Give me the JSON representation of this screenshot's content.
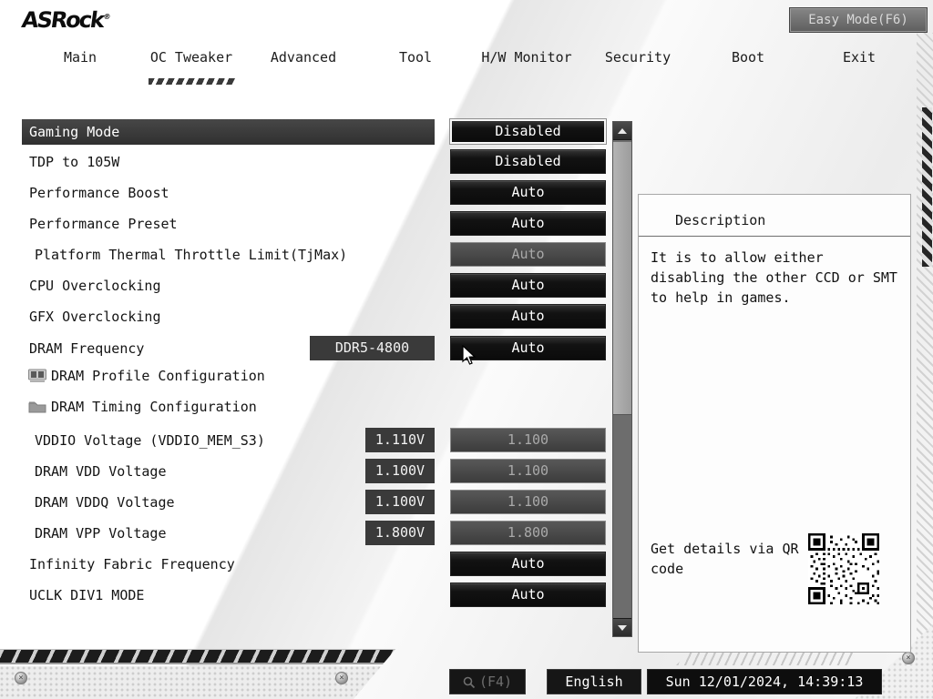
{
  "header": {
    "logo_text": "ASRock",
    "logo_mark": "®",
    "easy_mode_label": "Easy Mode(F6)"
  },
  "tabs": [
    {
      "label": "Main",
      "active": false
    },
    {
      "label": "OC Tweaker",
      "active": true
    },
    {
      "label": "Advanced",
      "active": false
    },
    {
      "label": "Tool",
      "active": false
    },
    {
      "label": "H/W Monitor",
      "active": false
    },
    {
      "label": "Security",
      "active": false
    },
    {
      "label": "Boot",
      "active": false
    },
    {
      "label": "Exit",
      "active": false
    }
  ],
  "settings": {
    "rows": [
      {
        "label": "Gaming Mode",
        "value": "Disabled",
        "state": "selected"
      },
      {
        "label": "TDP to 105W",
        "value": "Disabled",
        "state": "normal"
      },
      {
        "label": "Performance Boost",
        "value": "Auto",
        "state": "normal"
      },
      {
        "label": "Performance Preset",
        "value": "Auto",
        "state": "normal"
      },
      {
        "label": "Platform Thermal Throttle Limit(TjMax)",
        "value": "Auto",
        "state": "disabled"
      },
      {
        "label": "CPU Overclocking",
        "value": "Auto",
        "state": "normal"
      },
      {
        "label": "GFX Overclocking",
        "value": "Auto",
        "state": "normal"
      },
      {
        "label": "DRAM Frequency",
        "side": "DDR5-4800",
        "value": "Auto",
        "state": "normal"
      },
      {
        "label": "DRAM Profile Configuration",
        "icon": "dimm-icon"
      },
      {
        "label": "DRAM Timing Configuration",
        "icon": "folder-icon"
      },
      {
        "label": "VDDIO Voltage (VDDIO_MEM_S3)",
        "side": "1.110V",
        "value": "1.100",
        "state": "disabled"
      },
      {
        "label": "DRAM VDD Voltage",
        "side": "1.100V",
        "value": "1.100",
        "state": "disabled"
      },
      {
        "label": "DRAM VDDQ Voltage",
        "side": "1.100V",
        "value": "1.100",
        "state": "disabled"
      },
      {
        "label": "DRAM VPP Voltage",
        "side": "1.800V",
        "value": "1.800",
        "state": "disabled"
      },
      {
        "label": "Infinity Fabric Frequency",
        "value": "Auto",
        "state": "normal"
      },
      {
        "label": "UCLK DIV1 MODE",
        "value": "Auto",
        "state": "normal"
      }
    ]
  },
  "description": {
    "title": "Description",
    "body": "It is to allow either disabling the other CCD or SMT to help in games.",
    "qr_label": "Get details via QR code"
  },
  "footer": {
    "search_label": "(F4)",
    "language_label": "English",
    "datetime": "Sun 12/01/2024, 14:39:13"
  },
  "colors": {
    "button_bg": "#141414",
    "selected_border": "#f8f8f8",
    "disabled_text": "#a9a9a9",
    "highlight_row_bg": "#3b3b3b"
  }
}
